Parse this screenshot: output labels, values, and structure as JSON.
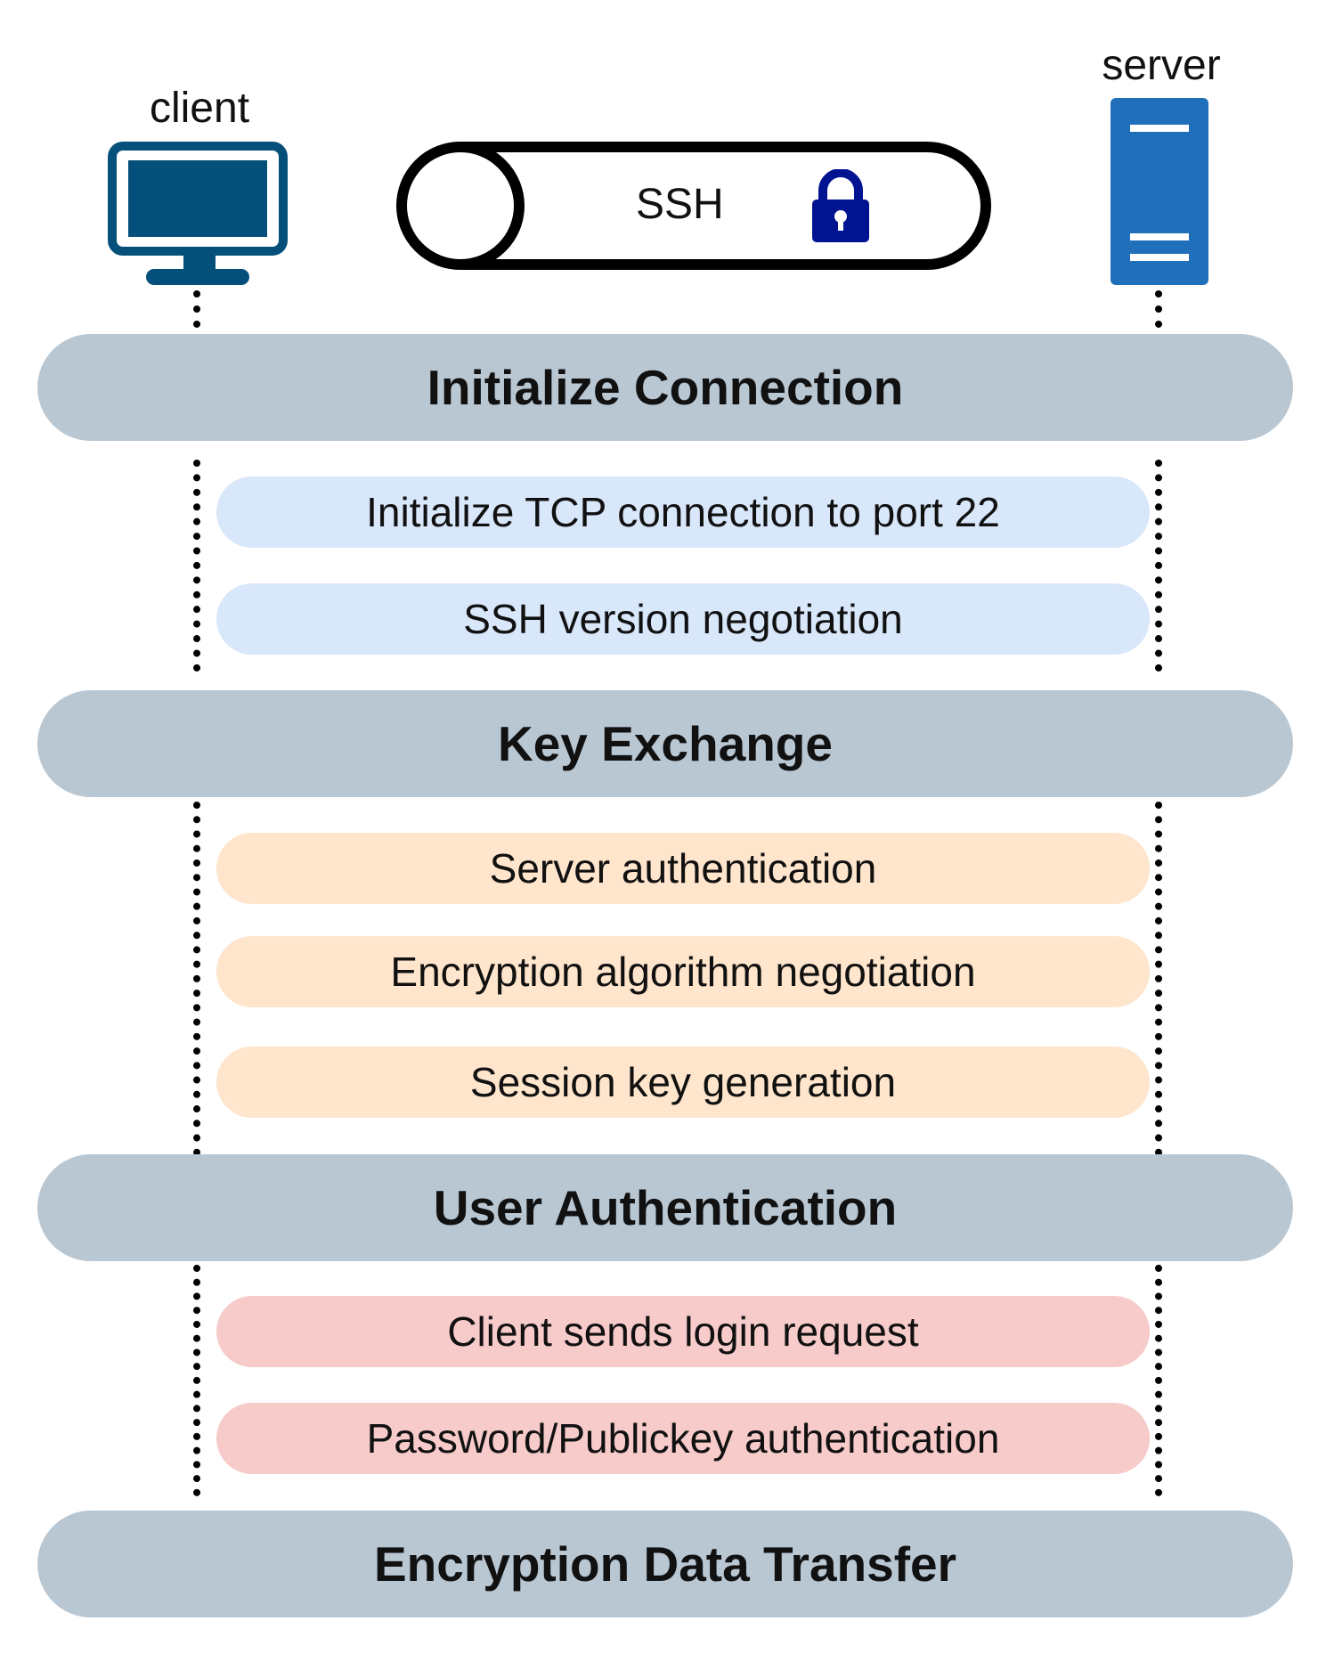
{
  "endpoints": {
    "client_label": "client",
    "server_label": "server"
  },
  "tunnel": {
    "label": "SSH",
    "icon": "lock-icon"
  },
  "colors": {
    "phase": "#b9c7d3",
    "init_step": "#d9e7fa",
    "key_step": "#fee5cc",
    "auth_step": "#f6cbca",
    "client_icon": "#05507a",
    "server_icon": "#1f6fbb",
    "lock": "#001492"
  },
  "phases": [
    {
      "title": "Initialize Connection",
      "steps": [
        "Initialize TCP connection to port 22",
        "SSH version negotiation"
      ]
    },
    {
      "title": "Key Exchange",
      "steps": [
        "Server authentication",
        "Encryption algorithm negotiation",
        "Session key generation"
      ]
    },
    {
      "title": "User Authentication",
      "steps": [
        "Client sends login request",
        "Password/Publickey authentication"
      ]
    },
    {
      "title": "Encryption Data Transfer",
      "steps": []
    }
  ]
}
